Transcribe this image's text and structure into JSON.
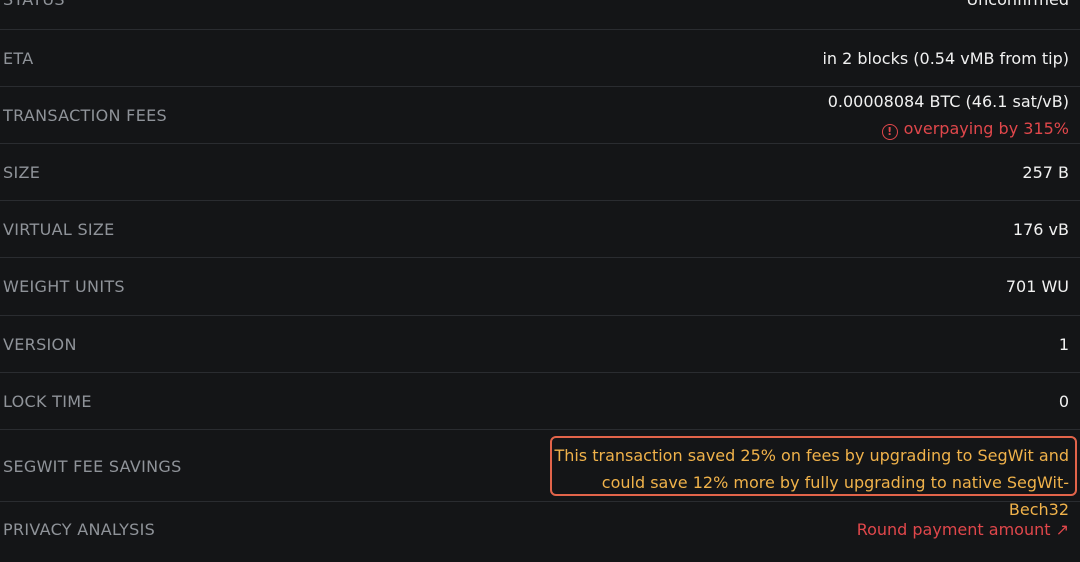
{
  "rows": [
    {
      "label": "STATUS",
      "value": "Unconfirmed"
    },
    {
      "label": "ETA",
      "value": "in 2 blocks (0.54 vMB from tip)"
    },
    {
      "label": "TRANSACTION FEES",
      "value": "0.00008084 BTC (46.1 sat/vB)",
      "warning": "overpaying by 315%"
    },
    {
      "label": "SIZE",
      "value": "257 B"
    },
    {
      "label": "VIRTUAL SIZE",
      "value": "176 vB"
    },
    {
      "label": "WEIGHT UNITS",
      "value": "701 WU"
    },
    {
      "label": "VERSION",
      "value": "1"
    },
    {
      "label": "LOCK TIME",
      "value": "0"
    },
    {
      "label": "SEGWIT FEE SAVINGS",
      "value_line1": "This transaction saved 25% on fees by upgrading to SegWit and",
      "value_line2": "could save 12% more by fully upgrading to native SegWit-Bech32"
    },
    {
      "label": "PRIVACY ANALYSIS",
      "value": "Round payment amount"
    }
  ],
  "icons": {
    "warning": "info-circle-icon"
  },
  "colors": {
    "background": "#141517",
    "label": "#8f9399",
    "value": "#f1f1f1",
    "danger": "#e0474b",
    "highlight": "#f0b24a",
    "box_border": "#e2644a"
  }
}
